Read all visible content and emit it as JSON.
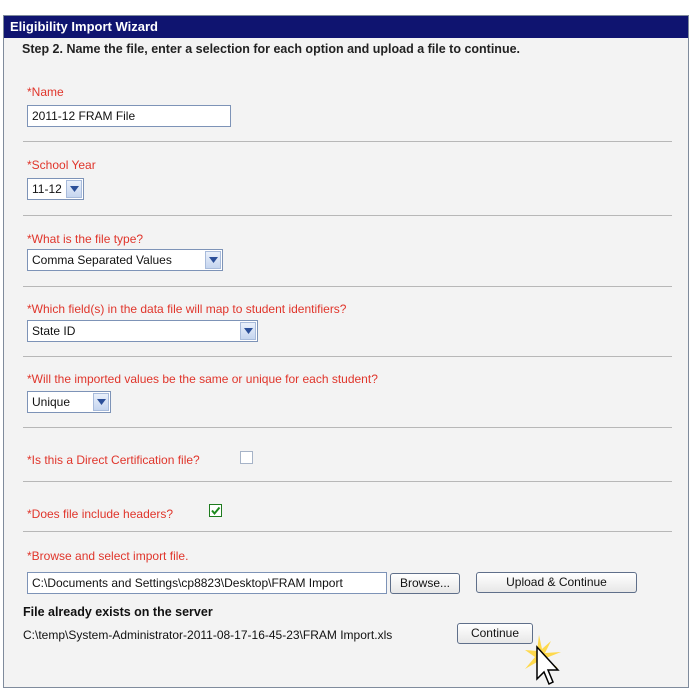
{
  "window": {
    "title": "Eligibility Import Wizard"
  },
  "step": {
    "text": "Step 2. Name the file, enter a selection for each option and upload a file to continue."
  },
  "fields": {
    "name": {
      "label": "*Name",
      "value": "2011-12 FRAM File"
    },
    "school_year": {
      "label": "*School Year",
      "value": "11-12"
    },
    "file_type": {
      "label": "*What is the file type?",
      "value": "Comma Separated Values"
    },
    "identifier_map": {
      "label": "*Which field(s) in the data file will map to student identifiers?",
      "value": "State ID"
    },
    "value_mode": {
      "label": "*Will the imported values be the same or unique for each student?",
      "value": "Unique"
    },
    "direct_cert": {
      "label": "*Is this a Direct Certification file?",
      "checked": false
    },
    "headers": {
      "label": "*Does file include headers?",
      "checked": true
    },
    "import_file": {
      "label": "*Browse and select import file.",
      "value": "C:\\Documents and Settings\\cp8823\\Desktop\\FRAM Import",
      "browse_label": "Browse...",
      "upload_label": "Upload & Continue"
    }
  },
  "server_file": {
    "heading": "File already exists on the server",
    "path": "C:\\temp\\System-Administrator-2011-08-17-16-45-23\\FRAM Import.xls",
    "continue_label": "Continue"
  },
  "colors": {
    "titlebar": "#0f1470",
    "required_label": "#e0352b",
    "panel": "#f3f3f3"
  },
  "icons": [
    "dropdown-arrow-icon",
    "checkmark-icon",
    "mouse-pointer-icon",
    "click-highlight-icon"
  ]
}
